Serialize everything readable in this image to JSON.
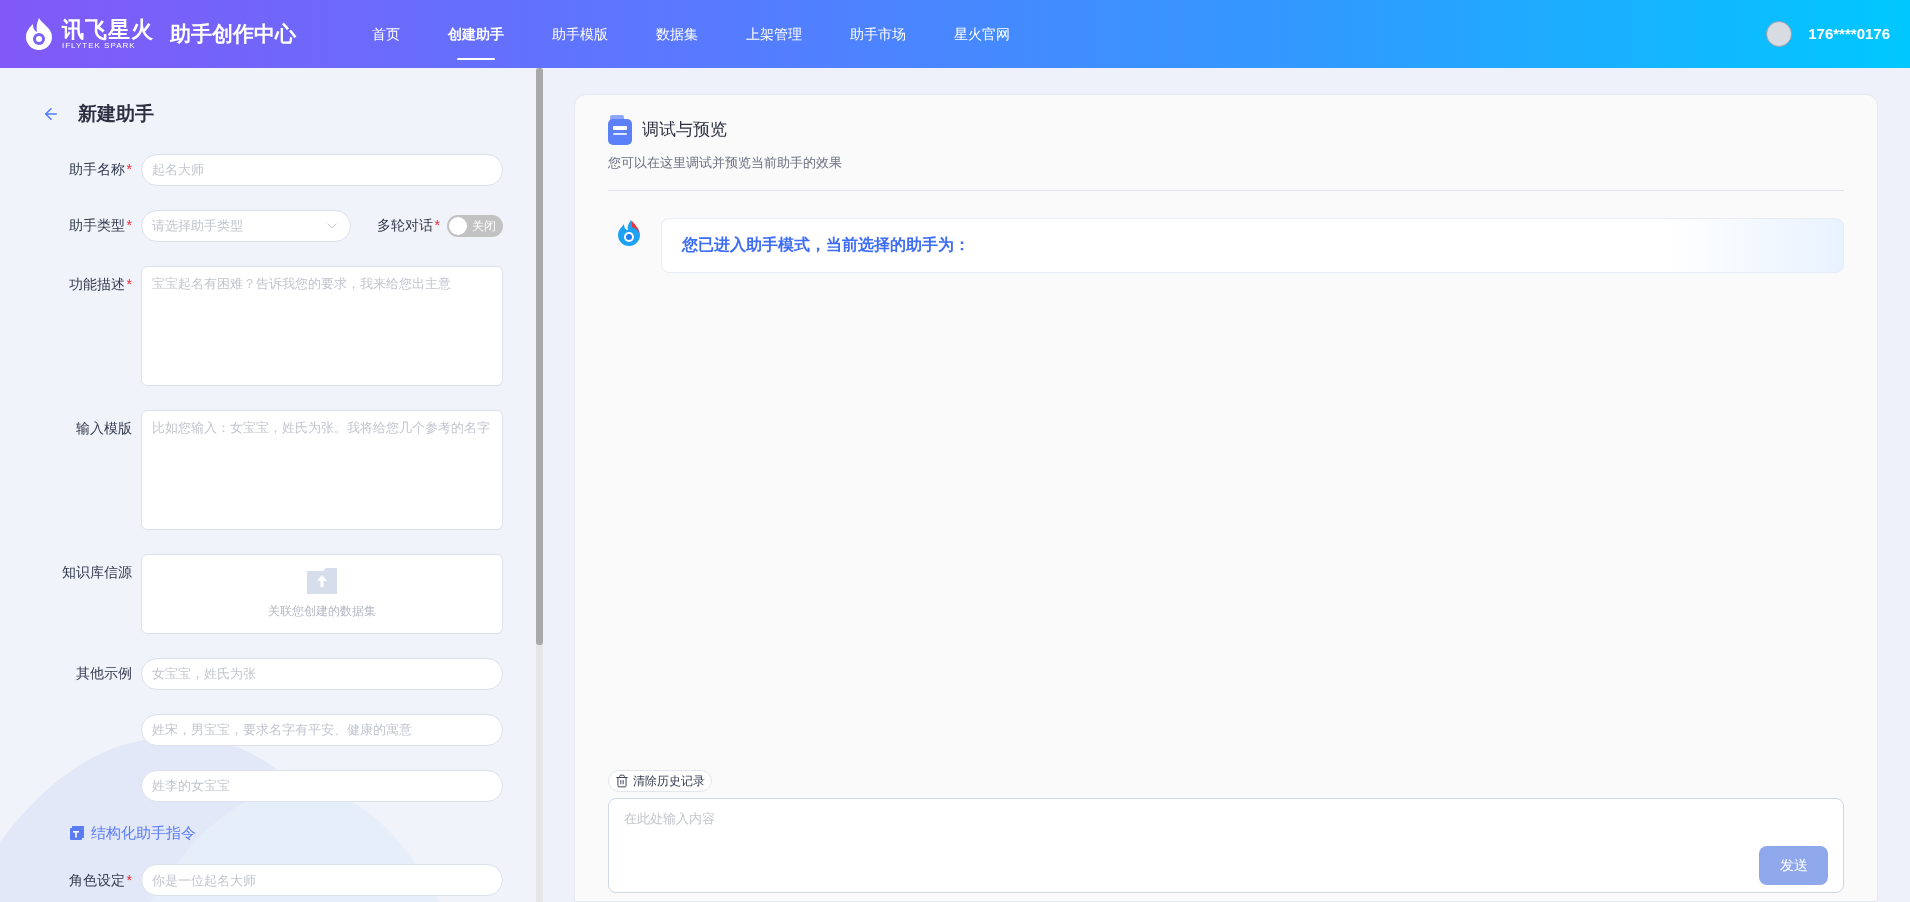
{
  "header": {
    "logo": {
      "name": "讯飞星火",
      "subtitle": "IFLYTEK SPARK"
    },
    "title": "助手创作中心",
    "nav": [
      {
        "label": "首页",
        "selected": false
      },
      {
        "label": "创建助手",
        "selected": true
      },
      {
        "label": "助手模版",
        "selected": false
      },
      {
        "label": "数据集",
        "selected": false
      },
      {
        "label": "上架管理",
        "selected": false
      },
      {
        "label": "助手市场",
        "selected": false
      },
      {
        "label": "星火官网",
        "selected": false
      }
    ],
    "user": {
      "phone": "176****0176"
    }
  },
  "form": {
    "title": "新建助手",
    "fields": [
      {
        "kind": "input",
        "label": "助手名称",
        "mark": "*",
        "placeholder": "起名大师"
      },
      {
        "kind": "select",
        "label": "助手类型",
        "mark": "*",
        "placeholder": "请选择助手类型",
        "extra": {
          "label": "多轮对话",
          "mark": "*",
          "toggle": {
            "on": false,
            "text": "关闭"
          }
        }
      },
      {
        "kind": "textarea",
        "label": "功能描述",
        "mark": "*",
        "placeholder": "宝宝起名有困难？告诉我您的要求，我来给您出主意"
      },
      {
        "kind": "textarea",
        "label": "输入模版",
        "placeholder": "比如您输入：女宝宝，姓氏为张。我将给您几个参考的名字"
      },
      {
        "kind": "upload",
        "label": "知识库信源",
        "text": "关联您创建的数据集"
      },
      {
        "kind": "input",
        "label": "其他示例",
        "placeholder": "女宝宝，姓氏为张"
      },
      {
        "kind": "input",
        "placeholder": "姓宋，男宝宝，要求名字有平安、健康的寓意"
      },
      {
        "kind": "input",
        "placeholder": "姓李的女宝宝"
      },
      {
        "kind": "heading",
        "label": "结构化助手指令"
      },
      {
        "kind": "input",
        "label": "角色设定",
        "mark": "*",
        "placeholder": "你是一位起名大师"
      }
    ]
  },
  "preview": {
    "title": "调试与预览",
    "subtitle": "您可以在这里调试并预览当前助手的效果",
    "messages": [
      {
        "text": "您已进入助手模式，当前选择的助手为："
      }
    ],
    "clear_button": "清除历史记录",
    "input": {
      "placeholder": "在此处输入内容"
    },
    "send_button": {
      "label": "发送",
      "disabled": true
    }
  }
}
